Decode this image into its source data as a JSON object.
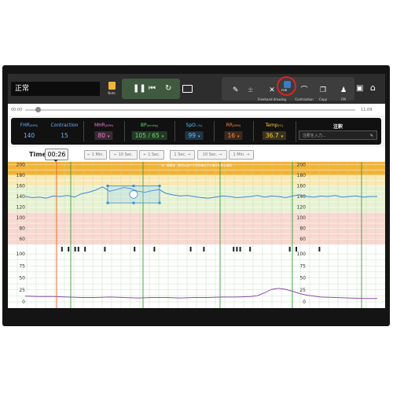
{
  "toolbar": {
    "status_text": "正常",
    "note_label": "Note",
    "tools": [
      {
        "label": "",
        "icon": "pen-icon"
      },
      {
        "label": "",
        "icon": "plus-icon"
      },
      {
        "label": "Freehand drawing",
        "icon": "freehand-icon"
      },
      {
        "label": "FHR",
        "icon": "fhr-icon"
      },
      {
        "label": "Contraction",
        "icon": "contraction-icon"
      },
      {
        "label": "Copy",
        "icon": "copy-icon"
      },
      {
        "label": "FM",
        "icon": "fm-icon"
      }
    ],
    "highlight_color": "#d9232a"
  },
  "scrubber": {
    "start": "00:00",
    "end": "11:09",
    "position": 0.03
  },
  "vitals": [
    {
      "label": "FHR",
      "unit": "(BPM)",
      "value": "140",
      "color": "#6fb3ff",
      "dropdown": false
    },
    {
      "label": "Contraction",
      "unit": "",
      "value": "15",
      "color": "#6fb3ff",
      "dropdown": false
    },
    {
      "label": "MHR",
      "unit": "(BPM)",
      "value": "80",
      "color": "#e97fd2",
      "dropdown": true
    },
    {
      "label": "BP",
      "unit": "(mmHg)",
      "value": "105 / 65",
      "color": "#6cd86f",
      "dropdown": true
    },
    {
      "label": "SpO",
      "unit": "₂ (%)",
      "value": "99",
      "color": "#4fc8ff",
      "dropdown": true
    },
    {
      "label": "RR",
      "unit": "(BPM)",
      "value": "16",
      "color": "#ff8a3a",
      "dropdown": true
    },
    {
      "label": "Temp",
      "unit": "(℃)",
      "value": "36.7",
      "color": "#ffd23a",
      "dropdown": true
    }
  ],
  "memo": {
    "label": "注釈",
    "placeholder": "注釈を入力..."
  },
  "time": {
    "label": "Time:",
    "value": "00:26",
    "buttons": [
      "← 1 Min.",
      "← 10 Sec.",
      "← 1 Sec.",
      "1 Sec. →",
      "10 Sec. →",
      "1 Min. →"
    ]
  },
  "chart_data": [
    {
      "type": "line",
      "name": "FHR",
      "yticks": [
        60,
        80,
        100,
        120,
        140,
        160,
        180,
        200
      ],
      "ylim": [
        50,
        205
      ],
      "x": [
        0,
        2,
        4,
        6,
        8,
        10,
        12,
        14,
        16,
        18,
        20,
        22,
        24,
        26,
        28,
        30,
        32,
        34,
        36,
        38,
        40,
        42,
        44,
        46,
        48,
        50,
        52,
        54,
        56,
        58,
        60,
        62,
        64,
        66,
        68,
        70,
        72,
        74,
        76,
        78,
        80,
        82,
        84,
        86,
        88,
        90,
        92,
        94,
        96,
        98,
        100
      ],
      "values": [
        140,
        138,
        139,
        137,
        141,
        140,
        142,
        139,
        145,
        148,
        152,
        158,
        150,
        153,
        157,
        155,
        150,
        148,
        151,
        153,
        146,
        143,
        141,
        142,
        140,
        138,
        137,
        139,
        141,
        140,
        138,
        139,
        140,
        142,
        139,
        141,
        140,
        138,
        141,
        143,
        140,
        139,
        141,
        140,
        142,
        139,
        140,
        141,
        139,
        140,
        140
      ],
      "color": "#3d87d4",
      "band_colors": [
        "#f2b234",
        "#fbe8b0",
        "#e7f2d3",
        "#f8d8d0"
      ],
      "banner": "注：観察者 - 胎児心拍や子宮収縮を示す描写を見る画面"
    },
    {
      "type": "line",
      "name": "Contraction",
      "yticks": [
        0,
        25,
        50,
        75,
        100
      ],
      "ylim": [
        0,
        100
      ],
      "x": [
        0,
        4,
        8,
        12,
        16,
        20,
        24,
        28,
        32,
        36,
        40,
        44,
        48,
        52,
        56,
        60,
        64,
        66,
        68,
        70,
        72,
        74,
        76,
        78,
        80,
        82,
        84,
        88,
        92,
        96,
        100
      ],
      "values": [
        12,
        11,
        11,
        10,
        9,
        9,
        10,
        9,
        8,
        9,
        9,
        8,
        9,
        9,
        10,
        10,
        11,
        13,
        19,
        26,
        28,
        26,
        22,
        17,
        14,
        12,
        10,
        9,
        8,
        7,
        7
      ],
      "color": "#8b4fa8",
      "movement_marks": [
        9,
        11,
        13,
        14,
        16,
        22,
        31,
        37,
        48,
        52,
        61,
        62,
        63,
        66,
        78,
        80,
        87
      ]
    }
  ]
}
